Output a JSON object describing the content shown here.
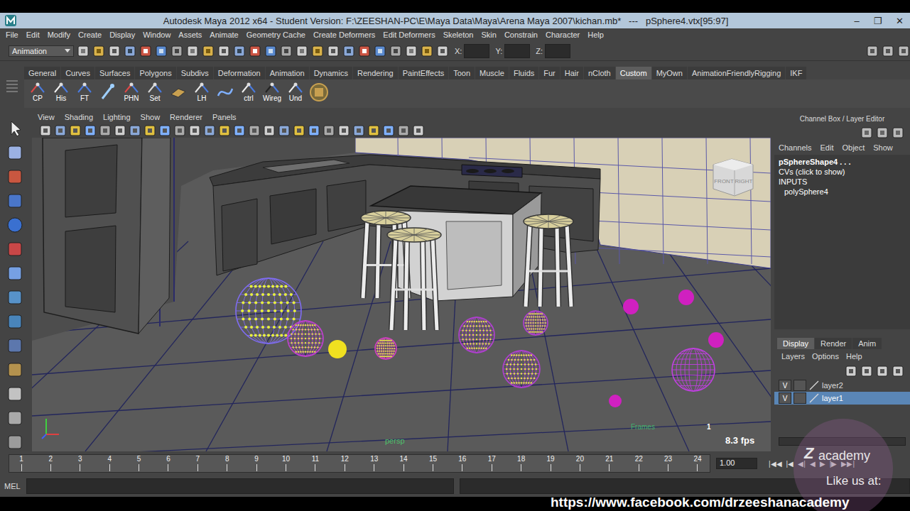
{
  "window": {
    "title": "Autodesk Maya 2012 x64 - Student Version: F:\\ZEESHAN-PC\\E\\Maya Data\\Maya\\Arena Maya 2007\\kichan.mb*   ---   pSphere4.vtx[95:97]",
    "controls": [
      "–",
      "❐",
      "✕"
    ]
  },
  "menu": [
    "File",
    "Edit",
    "Modify",
    "Create",
    "Display",
    "Window",
    "Assets",
    "Animate",
    "Geometry Cache",
    "Create Deformers",
    "Edit Deformers",
    "Skeleton",
    "Skin",
    "Constrain",
    "Character",
    "Help"
  ],
  "status_line": {
    "mode": "Animation",
    "coords": [
      "X:",
      "Y:",
      "Z:"
    ]
  },
  "shelf": {
    "tabs": [
      {
        "label": "General",
        "selected": false
      },
      {
        "label": "Curves",
        "selected": false
      },
      {
        "label": "Surfaces",
        "selected": false
      },
      {
        "label": "Polygons",
        "selected": false
      },
      {
        "label": "Subdivs",
        "selected": false
      },
      {
        "label": "Deformation",
        "selected": false
      },
      {
        "label": "Animation",
        "selected": false
      },
      {
        "label": "Dynamics",
        "selected": false
      },
      {
        "label": "Rendering",
        "selected": false
      },
      {
        "label": "PaintEffects",
        "selected": false
      },
      {
        "label": "Toon",
        "selected": false
      },
      {
        "label": "Muscle",
        "selected": false
      },
      {
        "label": "Fluids",
        "selected": false
      },
      {
        "label": "Fur",
        "selected": false
      },
      {
        "label": "Hair",
        "selected": false
      },
      {
        "label": "nCloth",
        "selected": false
      },
      {
        "label": "Custom",
        "selected": true
      },
      {
        "label": "MyOwn",
        "selected": false
      },
      {
        "label": "AnimationFriendlyRigging",
        "selected": false
      },
      {
        "label": "IKF",
        "selected": false
      }
    ],
    "buttons": [
      {
        "kind": "text",
        "label": "CP"
      },
      {
        "kind": "text",
        "label": "His"
      },
      {
        "kind": "text",
        "label": "FT"
      },
      {
        "kind": "glyph"
      },
      {
        "kind": "text",
        "label": "PHN"
      },
      {
        "kind": "text",
        "label": "Set"
      },
      {
        "kind": "glyph"
      },
      {
        "kind": "text",
        "label": "LH"
      },
      {
        "kind": "glyph"
      },
      {
        "kind": "text",
        "label": "ctrl"
      },
      {
        "kind": "text",
        "label": "Wireg"
      },
      {
        "kind": "text",
        "label": "Und"
      },
      {
        "kind": "glyph"
      }
    ]
  },
  "viewport": {
    "menu": [
      "View",
      "Shading",
      "Lighting",
      "Show",
      "Renderer",
      "Panels"
    ],
    "camera": "persp",
    "frames_label": "Frames",
    "frame": "1",
    "fps": "8.3 fps",
    "view_cube": [
      "FRONT",
      "RIGHT"
    ],
    "spheres": [
      {
        "kind": "vertices",
        "color": "#7f6cf2"
      },
      {
        "kind": "vertices",
        "color": "#c040d0"
      },
      {
        "kind": "solid",
        "color": "#f0e020"
      },
      {
        "kind": "vertices",
        "color": "#d040c0"
      },
      {
        "kind": "vertices",
        "color": "#b040d0"
      },
      {
        "kind": "vertices",
        "color": "#b040d0"
      },
      {
        "kind": "vertices",
        "color": "#b040d0"
      },
      {
        "kind": "solid",
        "color": "#d020c0"
      },
      {
        "kind": "solid",
        "color": "#d020c0"
      },
      {
        "kind": "solid",
        "color": "#d020c0"
      },
      {
        "kind": "wire",
        "color": "#c040e0"
      },
      {
        "kind": "solid",
        "color": "#d020c0"
      }
    ]
  },
  "channel_box": {
    "title": "Channel Box / Layer Editor",
    "menu": [
      "Channels",
      "Edit",
      "Object",
      "Show"
    ],
    "object": "pSphereShape4 . . .",
    "hint": "CVs (click to show)",
    "inputs_label": "INPUTS",
    "inputs": [
      "polySphere4"
    ]
  },
  "layer_editor": {
    "tabs": [
      {
        "label": "Display",
        "selected": true
      },
      {
        "label": "Render",
        "selected": false
      },
      {
        "label": "Anim",
        "selected": false
      }
    ],
    "menu": [
      "Layers",
      "Options",
      "Help"
    ],
    "layers": [
      {
        "name": "layer2",
        "visibility": "V",
        "selected": false
      },
      {
        "name": "layer1",
        "visibility": "V",
        "selected": true
      }
    ]
  },
  "time_slider": {
    "ticks": [
      "1",
      "2",
      "3",
      "4",
      "5",
      "6",
      "7",
      "8",
      "9",
      "10",
      "11",
      "12",
      "13",
      "14",
      "15",
      "16",
      "17",
      "18",
      "19",
      "20",
      "21",
      "22",
      "23",
      "24"
    ],
    "current": "1.00",
    "controls": [
      "|◀◀",
      "|◀",
      "◀|",
      "◀",
      "▶",
      "|▶",
      "▶▶|"
    ]
  },
  "command_line": {
    "label": "MEL"
  },
  "watermark": {
    "mark": "Z",
    "brand": "academy",
    "cta": "Like us at:",
    "url": "https://www.facebook.com/drzeeshanacademy"
  }
}
